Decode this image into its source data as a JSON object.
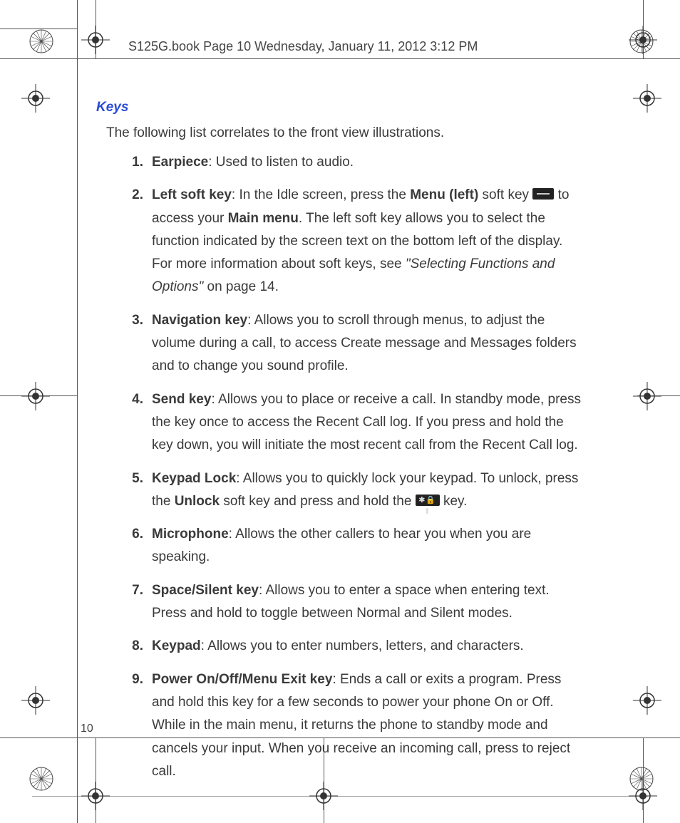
{
  "header": "S125G.book  Page 10  Wednesday, January 11, 2012  3:12 PM",
  "section_title": "Keys",
  "intro": "The following list correlates to the front view illustrations.",
  "page_number": "10",
  "items": [
    {
      "num": "1.",
      "title": "Earpiece",
      "rest": ": Used to listen to audio."
    },
    {
      "num": "2.",
      "title": "Left soft key",
      "rest_a": ": In the Idle screen, press the ",
      "bold_b": "Menu (left)",
      "rest_c": " soft key ",
      "rest_d": " to access your ",
      "bold_e": "Main menu",
      "rest_f": ". The left soft key allows you to select the function indicated by the screen text on the bottom left of the display. For more information about soft keys, see ",
      "italic_g": "\"Selecting Functions and Options\"",
      "rest_h": " on page 14."
    },
    {
      "num": "3.",
      "title": "Navigation key",
      "rest": ": Allows you to scroll through menus, to adjust the volume during a call, to access Create message and Messages folders and to change you sound profile."
    },
    {
      "num": "4.",
      "title": "Send key",
      "rest": ": Allows you to place or receive a call. In standby mode, press the key once to access the Recent Call log. If you press and hold the key down, you will initiate the most recent call from the Recent Call log."
    },
    {
      "num": "5.",
      "title": "Keypad Lock",
      "rest_a": ": Allows you to quickly lock your keypad. To unlock, press the ",
      "bold_b": "Unlock",
      "rest_c": " soft key and press and hold the ",
      "rest_d": " key."
    },
    {
      "num": "6.",
      "title": "Microphone",
      "rest": ": Allows the other callers to hear you when you are speaking."
    },
    {
      "num": "7.",
      "title": "Space/Silent key",
      "rest": ": Allows you to enter a space when entering text. Press and hold to toggle between Normal and Silent modes."
    },
    {
      "num": "8.",
      "title": "Keypad",
      "rest": ": Allows you to enter numbers, letters, and characters."
    },
    {
      "num": "9.",
      "title": "Power On/Off/Menu Exit key",
      "rest": ": Ends a call or exits a program. Press and hold this key for a few seconds to power your phone On or Off. While in the main menu, it returns the phone to standby mode and cancels your input. When you receive an incoming call, press to reject call."
    }
  ],
  "icons": {
    "menu": "menu-key-icon",
    "star": "star-lock-key-icon",
    "star_label": "✱🔒⬆"
  }
}
